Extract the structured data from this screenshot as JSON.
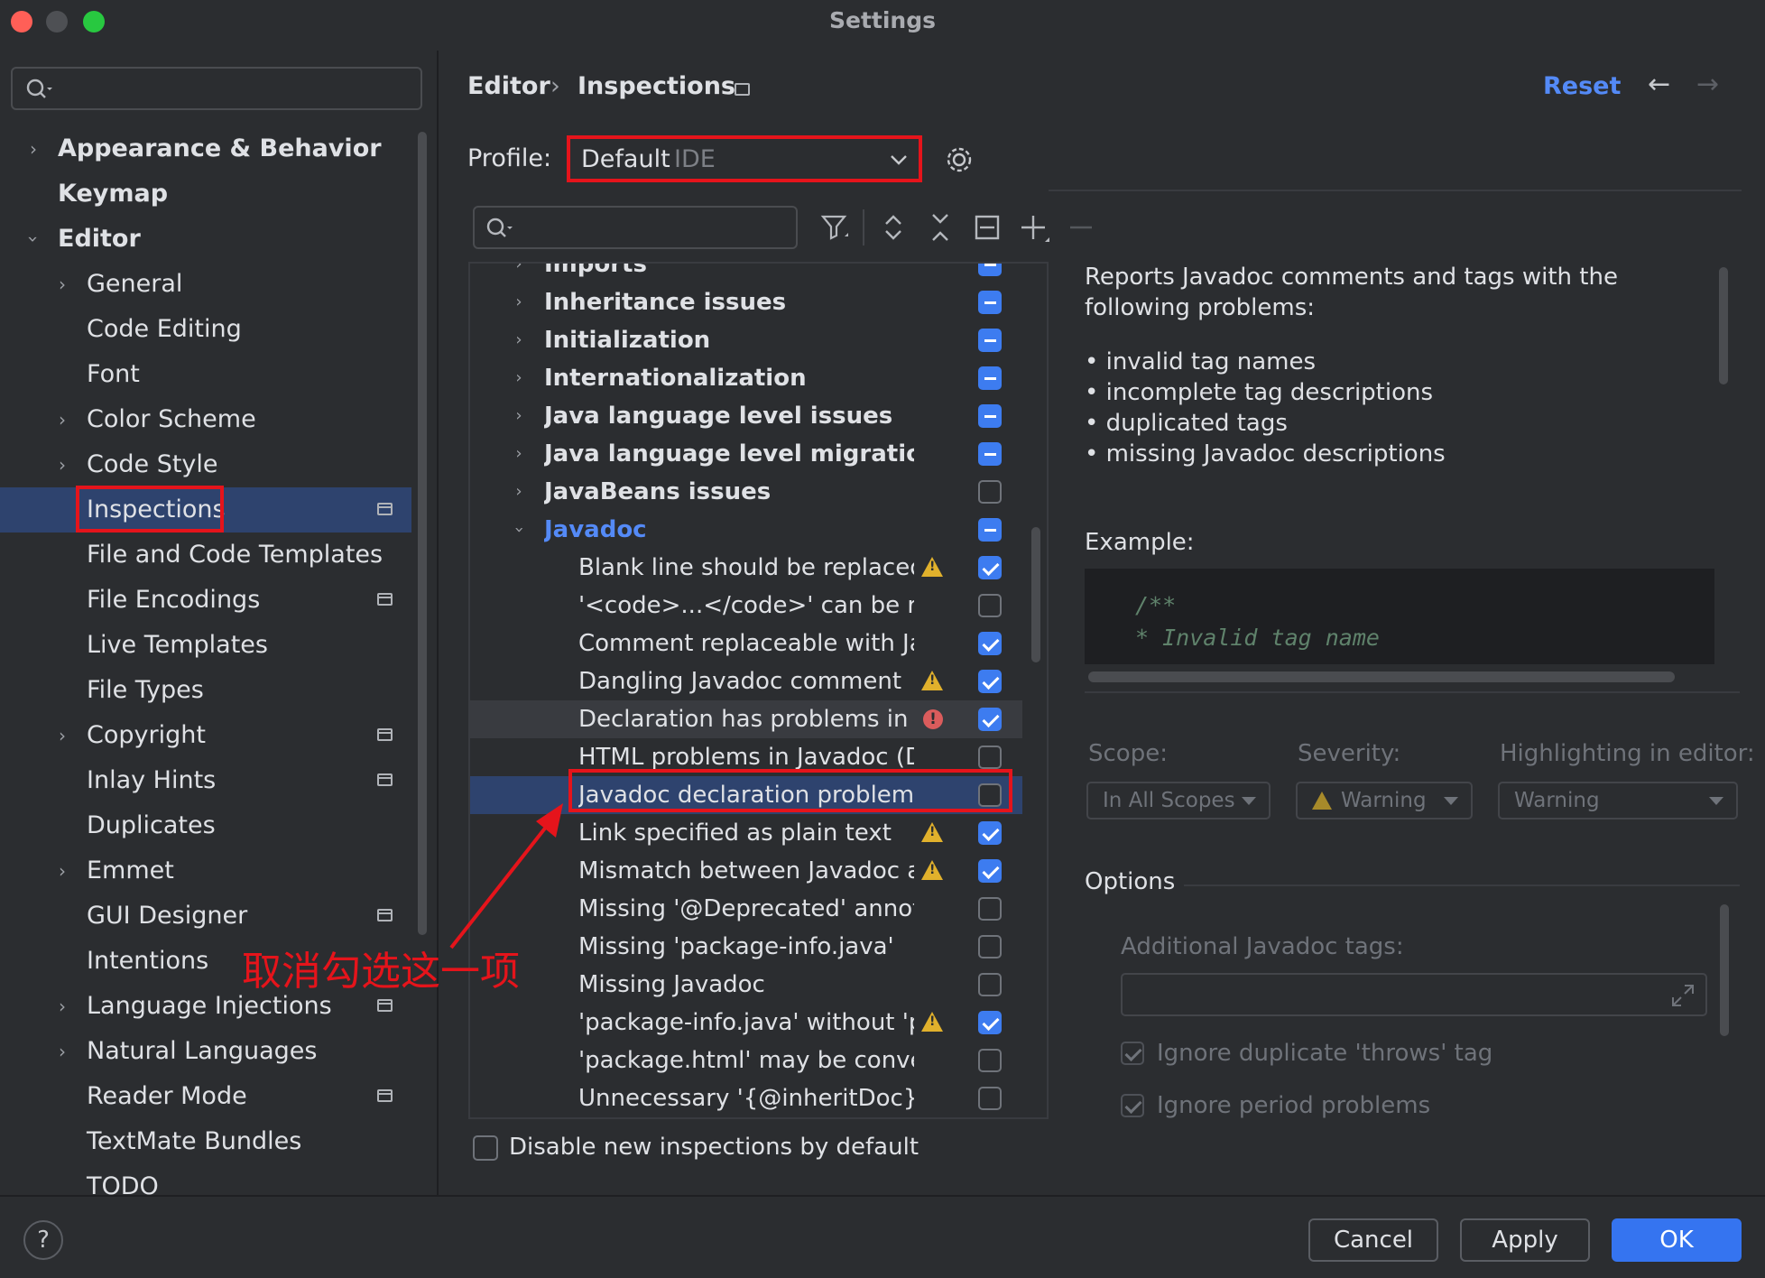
{
  "window": {
    "title": "Settings"
  },
  "sidebar": {
    "search_placeholder": "",
    "items": [
      {
        "label": "Appearance & Behavior"
      },
      {
        "label": "Keymap"
      },
      {
        "label": "Editor"
      },
      {
        "label": "General"
      },
      {
        "label": "Code Editing"
      },
      {
        "label": "Font"
      },
      {
        "label": "Color Scheme"
      },
      {
        "label": "Code Style"
      },
      {
        "label": "Inspections"
      },
      {
        "label": "File and Code Templates"
      },
      {
        "label": "File Encodings"
      },
      {
        "label": "Live Templates"
      },
      {
        "label": "File Types"
      },
      {
        "label": "Copyright"
      },
      {
        "label": "Inlay Hints"
      },
      {
        "label": "Duplicates"
      },
      {
        "label": "Emmet"
      },
      {
        "label": "GUI Designer"
      },
      {
        "label": "Intentions"
      },
      {
        "label": "Language Injections"
      },
      {
        "label": "Natural Languages"
      },
      {
        "label": "Reader Mode"
      },
      {
        "label": "TextMate Bundles"
      },
      {
        "label": "TODO"
      }
    ]
  },
  "header": {
    "crumb_parent": "Editor",
    "crumb_sep": "›",
    "crumb_current": "Inspections",
    "reset_label": "Reset"
  },
  "profile": {
    "label": "Profile:",
    "value": "Default",
    "scope": "IDE"
  },
  "inspections": {
    "search_placeholder": "",
    "rows": [
      {
        "label": "Imports"
      },
      {
        "label": "Inheritance issues"
      },
      {
        "label": "Initialization"
      },
      {
        "label": "Internationalization"
      },
      {
        "label": "Java language level issues"
      },
      {
        "label": "Java language level migration aids"
      },
      {
        "label": "JavaBeans issues"
      },
      {
        "label": "Javadoc"
      },
      {
        "label": "Blank line should be replaced with <p>"
      },
      {
        "label": "'<code>...</code>' can be replaced with '{@code ...}'"
      },
      {
        "label": "Comment replaceable with Javadoc"
      },
      {
        "label": "Dangling Javadoc comment"
      },
      {
        "label": "Declaration has problems in Javadoc references"
      },
      {
        "label": "HTML problems in Javadoc (DocLint)"
      },
      {
        "label": "Javadoc declaration problems"
      },
      {
        "label": "Link specified as plain text"
      },
      {
        "label": "Mismatch between Javadoc and code"
      },
      {
        "label": "Missing '@Deprecated' annotation"
      },
      {
        "label": "Missing 'package-info.java'"
      },
      {
        "label": "Missing Javadoc"
      },
      {
        "label": "'package-info.java' without 'package' statement"
      },
      {
        "label": "'package.html' may be converted to 'package-info.java'"
      },
      {
        "label": "Unnecessary '{@inheritDoc}' Javadoc comment"
      }
    ],
    "disable_new_label": "Disable new inspections by default"
  },
  "description": {
    "intro": "Reports Javadoc comments and tags with the following problems:",
    "bullets": [
      "invalid tag names",
      "incomplete tag descriptions",
      "duplicated tags",
      "missing Javadoc descriptions"
    ],
    "example_label": "Example:",
    "code_line1": "/**",
    "code_line2": " * Invalid tag name"
  },
  "settings": {
    "scope_label": "Scope:",
    "scope_value": "In All Scopes",
    "severity_label": "Severity:",
    "severity_value": "Warning",
    "highlight_label": "Highlighting in editor:",
    "highlight_value": "Warning",
    "options_label": "Options",
    "additional_tags_label": "Additional Javadoc tags:",
    "ignore_throws_label": "Ignore duplicate 'throws' tag",
    "ignore_period_label": "Ignore period problems"
  },
  "annotation": {
    "text": "取消勾选这一项",
    "color": "#e5141b"
  },
  "footer": {
    "help": "?",
    "cancel": "Cancel",
    "apply": "Apply",
    "ok": "OK"
  },
  "colors": {
    "accent": "#3d7cf0",
    "selection": "#2e436e",
    "warning": "#e1b12c",
    "error": "#db5c5c",
    "background": "#2b2d30"
  }
}
